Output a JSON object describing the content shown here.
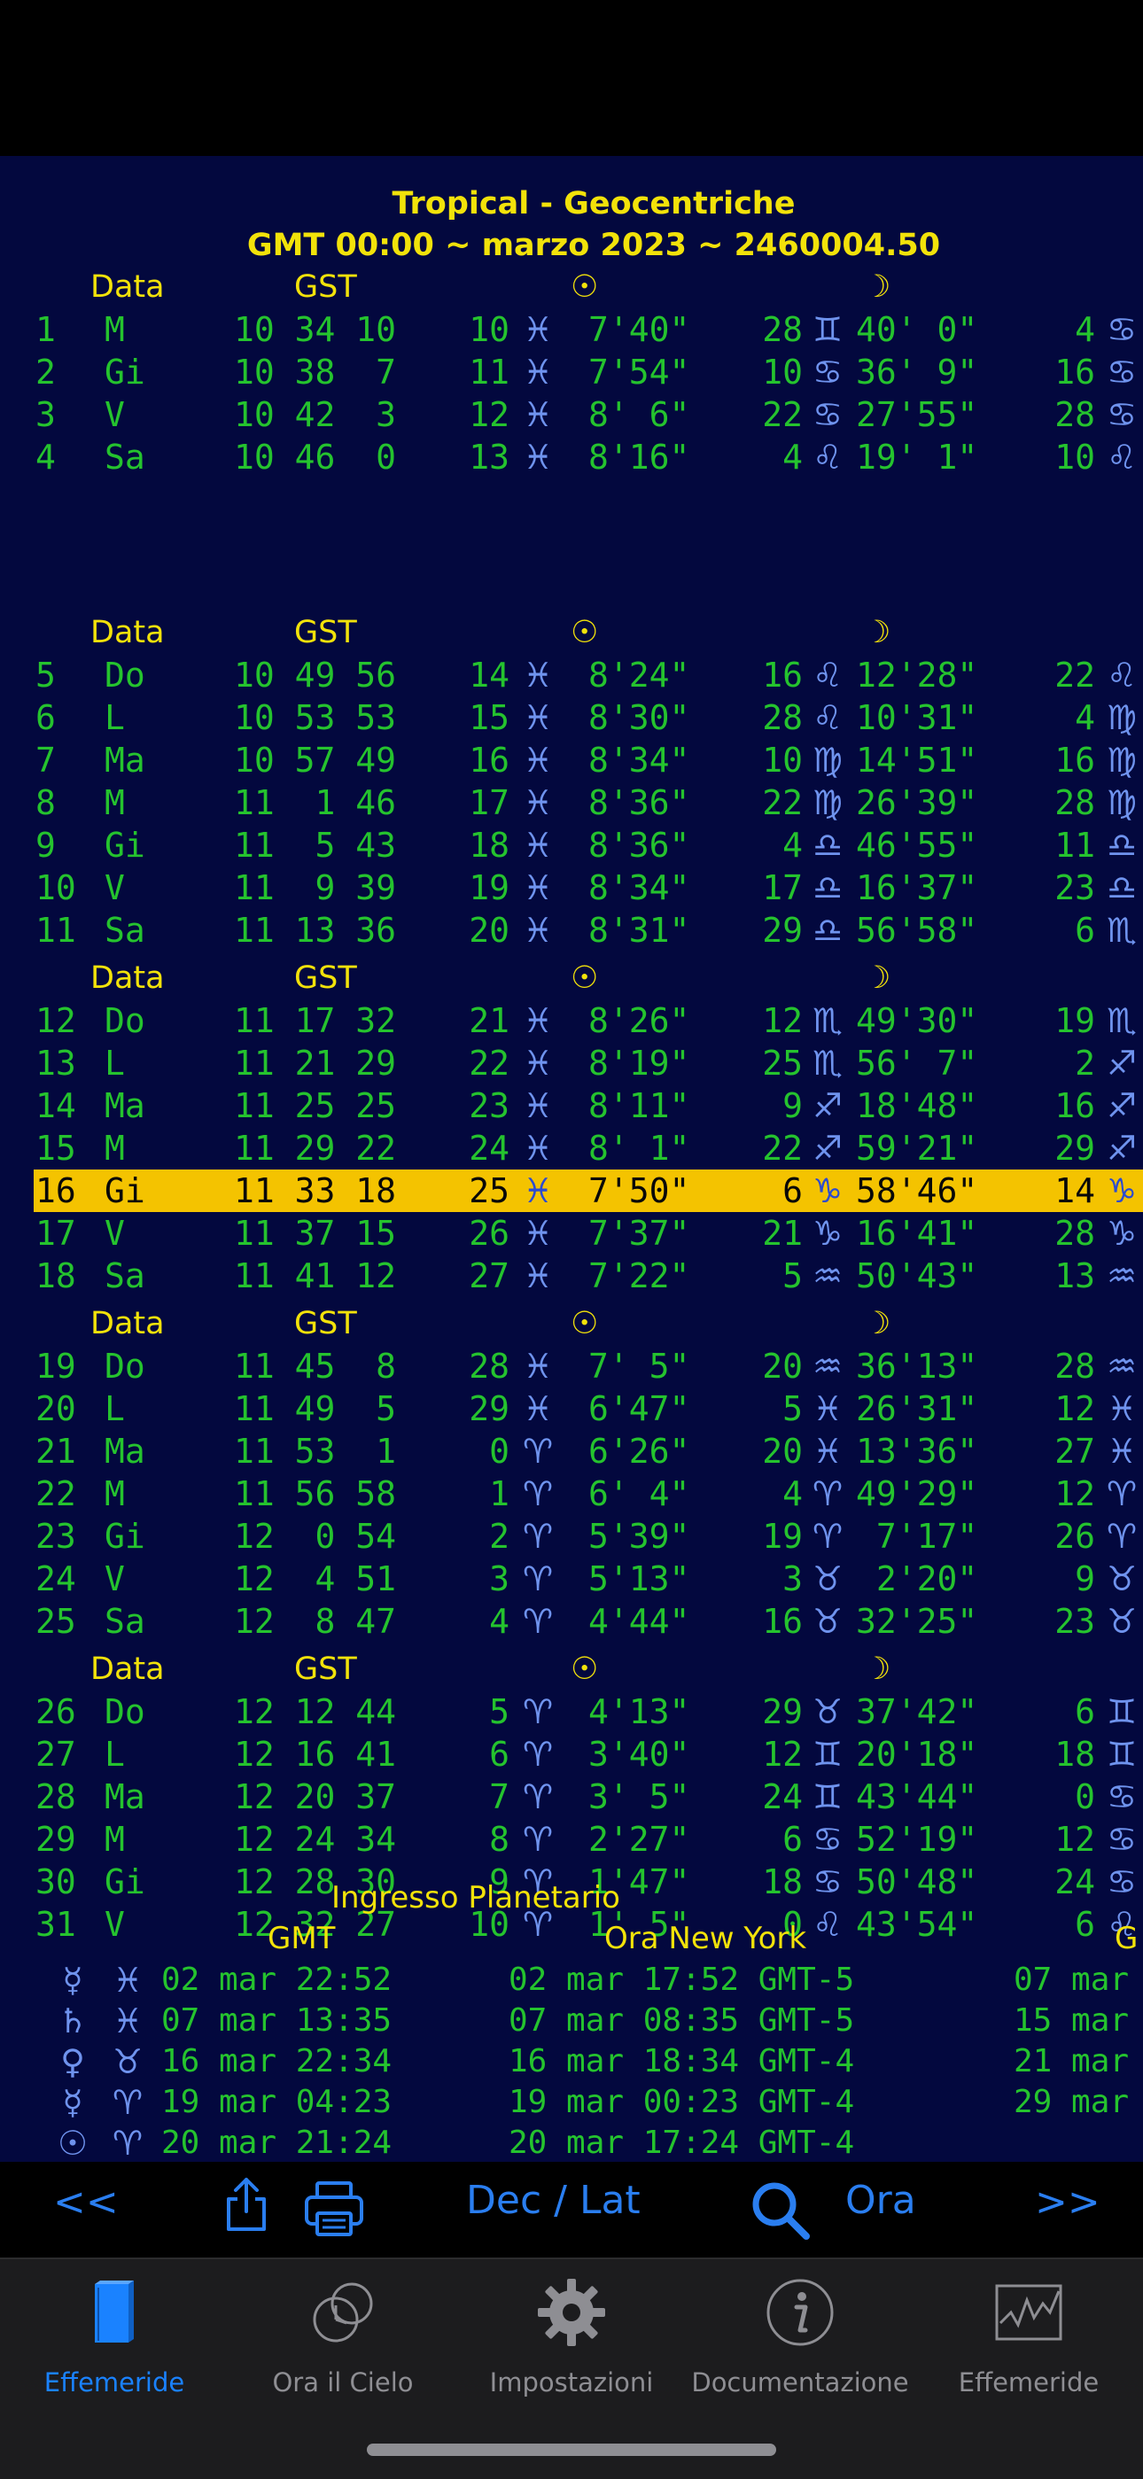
{
  "header": {
    "title_line1": "Tropical - Geocentriche",
    "title_line2": "GMT 00:00 ~ marzo 2023 ~ 2460004.50"
  },
  "table_headers": {
    "date": "Data",
    "gst": "GST",
    "sun": "☉",
    "moon": "☽",
    "mercury_partial": "☽"
  },
  "groups": [
    {
      "rows": [
        {
          "d": "1",
          "wd": "M",
          "gst": "10 34 10",
          "sd": "10",
          "ss": "♓",
          "sm": "7'40\"",
          "md": "28",
          "ms": "♊",
          "mm": "40' 0\"",
          "xd": "4",
          "xs": "♋"
        },
        {
          "d": "2",
          "wd": "Gi",
          "gst": "10 38  7",
          "sd": "11",
          "ss": "♓",
          "sm": "7'54\"",
          "md": "10",
          "ms": "♋",
          "mm": "36' 9\"",
          "xd": "16",
          "xs": "♋"
        },
        {
          "d": "3",
          "wd": "V",
          "gst": "10 42  3",
          "sd": "12",
          "ss": "♓",
          "sm": "8' 6\"",
          "md": "22",
          "ms": "♋",
          "mm": "27'55\"",
          "xd": "28",
          "xs": "♋"
        },
        {
          "d": "4",
          "wd": "Sa",
          "gst": "10 46  0",
          "sd": "13",
          "ss": "♓",
          "sm": "8'16\"",
          "md": "4",
          "ms": "♌",
          "mm": "19' 1\"",
          "xd": "10",
          "xs": "♌"
        }
      ]
    },
    {
      "rows": [
        {
          "d": "5",
          "wd": "Do",
          "gst": "10 49 56",
          "sd": "14",
          "ss": "♓",
          "sm": "8'24\"",
          "md": "16",
          "ms": "♌",
          "mm": "12'28\"",
          "xd": "22",
          "xs": "♌"
        },
        {
          "d": "6",
          "wd": "L",
          "gst": "10 53 53",
          "sd": "15",
          "ss": "♓",
          "sm": "8'30\"",
          "md": "28",
          "ms": "♌",
          "mm": "10'31\"",
          "xd": "4",
          "xs": "♍"
        },
        {
          "d": "7",
          "wd": "Ma",
          "gst": "10 57 49",
          "sd": "16",
          "ss": "♓",
          "sm": "8'34\"",
          "md": "10",
          "ms": "♍",
          "mm": "14'51\"",
          "xd": "16",
          "xs": "♍"
        },
        {
          "d": "8",
          "wd": "M",
          "gst": "11  1 46",
          "sd": "17",
          "ss": "♓",
          "sm": "8'36\"",
          "md": "22",
          "ms": "♍",
          "mm": "26'39\"",
          "xd": "28",
          "xs": "♍"
        },
        {
          "d": "9",
          "wd": "Gi",
          "gst": "11  5 43",
          "sd": "18",
          "ss": "♓",
          "sm": "8'36\"",
          "md": "4",
          "ms": "♎",
          "mm": "46'55\"",
          "xd": "11",
          "xs": "♎"
        },
        {
          "d": "10",
          "wd": "V",
          "gst": "11  9 39",
          "sd": "19",
          "ss": "♓",
          "sm": "8'34\"",
          "md": "17",
          "ms": "♎",
          "mm": "16'37\"",
          "xd": "23",
          "xs": "♎"
        },
        {
          "d": "11",
          "wd": "Sa",
          "gst": "11 13 36",
          "sd": "20",
          "ss": "♓",
          "sm": "8'31\"",
          "md": "29",
          "ms": "♎",
          "mm": "56'58\"",
          "xd": "6",
          "xs": "♏"
        }
      ]
    },
    {
      "rows": [
        {
          "d": "12",
          "wd": "Do",
          "gst": "11 17 32",
          "sd": "21",
          "ss": "♓",
          "sm": "8'26\"",
          "md": "12",
          "ms": "♏",
          "mm": "49'30\"",
          "xd": "19",
          "xs": "♏"
        },
        {
          "d": "13",
          "wd": "L",
          "gst": "11 21 29",
          "sd": "22",
          "ss": "♓",
          "sm": "8'19\"",
          "md": "25",
          "ms": "♏",
          "mm": "56' 7\"",
          "xd": "2",
          "xs": "♐"
        },
        {
          "d": "14",
          "wd": "Ma",
          "gst": "11 25 25",
          "sd": "23",
          "ss": "♓",
          "sm": "8'11\"",
          "md": "9",
          "ms": "♐",
          "mm": "18'48\"",
          "xd": "16",
          "xs": "♐"
        },
        {
          "d": "15",
          "wd": "M",
          "gst": "11 29 22",
          "sd": "24",
          "ss": "♓",
          "sm": "8' 1\"",
          "md": "22",
          "ms": "♐",
          "mm": "59'21\"",
          "xd": "29",
          "xs": "♐"
        },
        {
          "d": "16",
          "wd": "Gi",
          "gst": "11 33 18",
          "sd": "25",
          "ss": "♓",
          "sm": "7'50\"",
          "md": "6",
          "ms": "♑",
          "mm": "58'46\"",
          "xd": "14",
          "xs": "♑",
          "highlight": true
        },
        {
          "d": "17",
          "wd": "V",
          "gst": "11 37 15",
          "sd": "26",
          "ss": "♓",
          "sm": "7'37\"",
          "md": "21",
          "ms": "♑",
          "mm": "16'41\"",
          "xd": "28",
          "xs": "♑"
        },
        {
          "d": "18",
          "wd": "Sa",
          "gst": "11 41 12",
          "sd": "27",
          "ss": "♓",
          "sm": "7'22\"",
          "md": "5",
          "ms": "♒",
          "mm": "50'43\"",
          "xd": "13",
          "xs": "♒"
        }
      ]
    },
    {
      "rows": [
        {
          "d": "19",
          "wd": "Do",
          "gst": "11 45  8",
          "sd": "28",
          "ss": "♓",
          "sm": "7' 5\"",
          "md": "20",
          "ms": "♒",
          "mm": "36'13\"",
          "xd": "28",
          "xs": "♒"
        },
        {
          "d": "20",
          "wd": "L",
          "gst": "11 49  5",
          "sd": "29",
          "ss": "♓",
          "sm": "6'47\"",
          "md": "5",
          "ms": "♓",
          "mm": "26'31\"",
          "xd": "12",
          "xs": "♓"
        },
        {
          "d": "21",
          "wd": "Ma",
          "gst": "11 53  1",
          "sd": "0",
          "ss": "♈",
          "sm": "6'26\"",
          "md": "20",
          "ms": "♓",
          "mm": "13'36\"",
          "xd": "27",
          "xs": "♓"
        },
        {
          "d": "22",
          "wd": "M",
          "gst": "11 56 58",
          "sd": "1",
          "ss": "♈",
          "sm": "6' 4\"",
          "md": "4",
          "ms": "♈",
          "mm": "49'29\"",
          "xd": "12",
          "xs": "♈"
        },
        {
          "d": "23",
          "wd": "Gi",
          "gst": "12  0 54",
          "sd": "2",
          "ss": "♈",
          "sm": "5'39\"",
          "md": "19",
          "ms": "♈",
          "mm": " 7'17\"",
          "xd": "26",
          "xs": "♈"
        },
        {
          "d": "24",
          "wd": "V",
          "gst": "12  4 51",
          "sd": "3",
          "ss": "♈",
          "sm": "5'13\"",
          "md": "3",
          "ms": "♉",
          "mm": " 2'20\"",
          "xd": "9",
          "xs": "♉"
        },
        {
          "d": "25",
          "wd": "Sa",
          "gst": "12  8 47",
          "sd": "4",
          "ss": "♈",
          "sm": "4'44\"",
          "md": "16",
          "ms": "♉",
          "mm": "32'25\"",
          "xd": "23",
          "xs": "♉"
        }
      ]
    },
    {
      "rows": [
        {
          "d": "26",
          "wd": "Do",
          "gst": "12 12 44",
          "sd": "5",
          "ss": "♈",
          "sm": "4'13\"",
          "md": "29",
          "ms": "♉",
          "mm": "37'42\"",
          "xd": "6",
          "xs": "♊"
        },
        {
          "d": "27",
          "wd": "L",
          "gst": "12 16 41",
          "sd": "6",
          "ss": "♈",
          "sm": "3'40\"",
          "md": "12",
          "ms": "♊",
          "mm": "20'18\"",
          "xd": "18",
          "xs": "♊"
        },
        {
          "d": "28",
          "wd": "Ma",
          "gst": "12 20 37",
          "sd": "7",
          "ss": "♈",
          "sm": "3' 5\"",
          "md": "24",
          "ms": "♊",
          "mm": "43'44\"",
          "xd": "0",
          "xs": "♋"
        },
        {
          "d": "29",
          "wd": "M",
          "gst": "12 24 34",
          "sd": "8",
          "ss": "♈",
          "sm": "2'27\"",
          "md": "6",
          "ms": "♋",
          "mm": "52'19\"",
          "xd": "12",
          "xs": "♋"
        },
        {
          "d": "30",
          "wd": "Gi",
          "gst": "12 28 30",
          "sd": "9",
          "ss": "♈",
          "sm": "1'47\"",
          "md": "18",
          "ms": "♋",
          "mm": "50'48\"",
          "xd": "24",
          "xs": "♋"
        },
        {
          "d": "31",
          "wd": "V",
          "gst": "12 32 27",
          "sd": "10",
          "ss": "♈",
          "sm": "1' 5\"",
          "md": "0",
          "ms": "♌",
          "mm": "43'54\"",
          "xd": "6",
          "xs": "♌"
        }
      ]
    }
  ],
  "ingress": {
    "title": "Ingresso Planetario",
    "col_gmt": "GMT",
    "col_ny": "Ora New York",
    "col_partial": "G",
    "rows": [
      {
        "planet": "☿",
        "sign": "♓",
        "gmt": "02 mar 22:52",
        "ny": "02 mar 17:52 GMT-5",
        "extra": "07 mar"
      },
      {
        "planet": "♄",
        "sign": "♓",
        "gmt": "07 mar 13:35",
        "ny": "07 mar 08:35 GMT-5",
        "extra": "15 mar"
      },
      {
        "planet": "♀",
        "sign": "♉",
        "gmt": "16 mar 22:34",
        "ny": "16 mar 18:34 GMT-4",
        "extra": "21 mar"
      },
      {
        "planet": "☿",
        "sign": "♈",
        "gmt": "19 mar 04:23",
        "ny": "19 mar 00:23 GMT-4",
        "extra": "29 mar"
      },
      {
        "planet": "☉",
        "sign": "♈",
        "gmt": "20 mar 21:24",
        "ny": "20 mar 17:24 GMT-4",
        "extra": ""
      }
    ]
  },
  "toolbar": {
    "prev": "<<",
    "declat": "Dec / Lat",
    "ora": "Ora",
    "next": ">>"
  },
  "tabs": [
    {
      "label": "Effemeride",
      "icon": "book-icon",
      "active": true
    },
    {
      "label": "Ora il Cielo",
      "icon": "sky-clock-icon",
      "active": false
    },
    {
      "label": "Impostazioni",
      "icon": "gear-icon",
      "active": false
    },
    {
      "label": "Documentazione",
      "icon": "info-icon",
      "active": false
    },
    {
      "label": "Effemeride",
      "icon": "chart-icon",
      "active": false
    }
  ],
  "colors": {
    "background": "#03083e",
    "accent_yellow": "#f2e20a",
    "value_green": "#25c32e",
    "sign_blue": "#6f93ee",
    "highlight": "#f4c300",
    "tab_active": "#1a82ff"
  }
}
